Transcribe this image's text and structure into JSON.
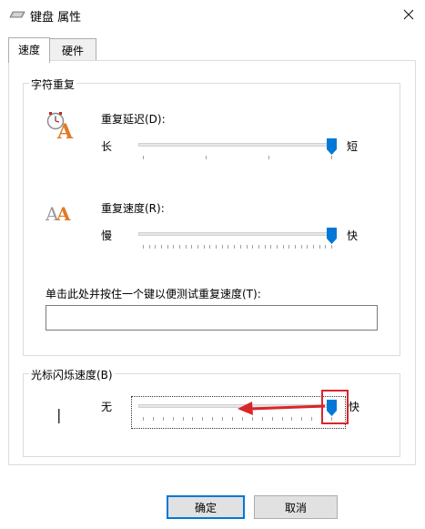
{
  "window": {
    "title": "键盘 属性",
    "icons": {
      "app": "keyboard-icon",
      "close": "close-icon"
    }
  },
  "tabs": [
    {
      "label": "速度",
      "active": true
    },
    {
      "label": "硬件",
      "active": false
    }
  ],
  "char_repeat": {
    "group_label": "字符重复",
    "delay": {
      "label": "重复延迟(D):",
      "min_label": "长",
      "max_label": "短",
      "value_fraction": 1.0,
      "icon": "clock-letter-a-icon"
    },
    "rate": {
      "label": "重复速度(R):",
      "min_label": "慢",
      "max_label": "快",
      "value_fraction": 1.0,
      "icon": "double-letter-a-icon"
    },
    "test": {
      "label": "单击此处并按住一个键以便测试重复速度(T):",
      "value": ""
    }
  },
  "cursor_blink": {
    "group_label": "光标闪烁速度(B)",
    "min_label": "无",
    "max_label": "快",
    "value_fraction": 1.0,
    "icon": "text-cursor-icon"
  },
  "buttons": {
    "ok": "确定",
    "cancel": "取消"
  },
  "colors": {
    "accent": "#0078d7",
    "annotation": "#d9262a"
  }
}
